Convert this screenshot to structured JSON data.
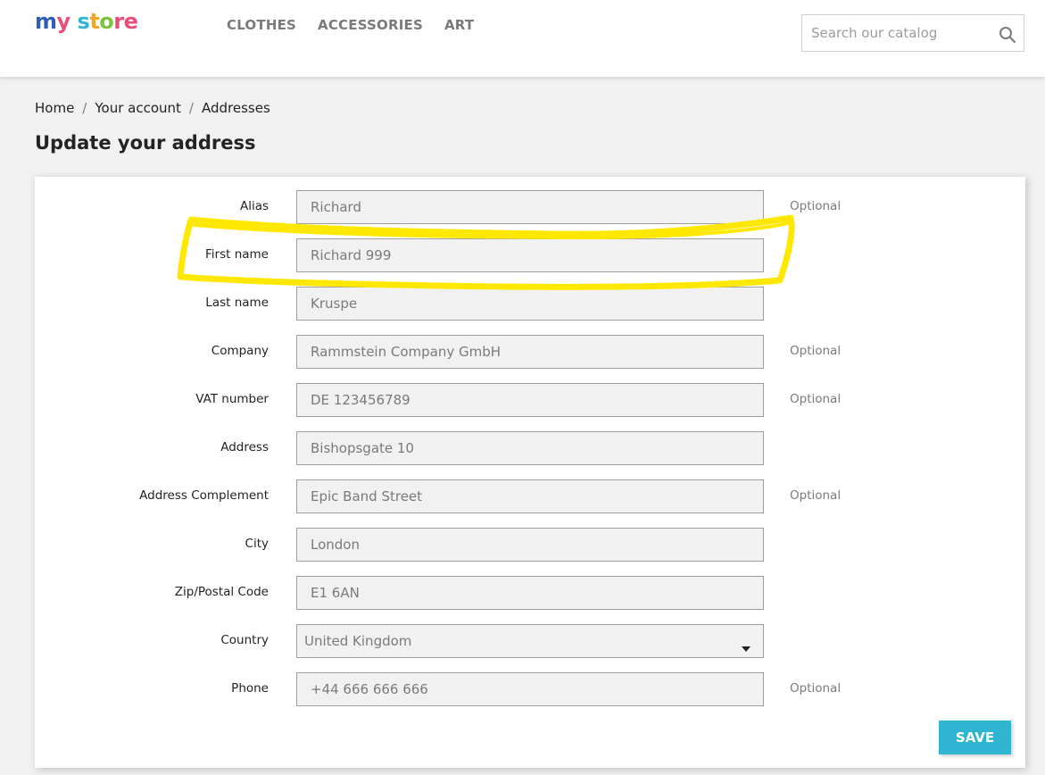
{
  "header": {
    "logo": [
      "m",
      "y",
      " s",
      "t",
      "o",
      "re"
    ],
    "nav": [
      "CLOTHES",
      "ACCESSORIES",
      "ART"
    ],
    "search_placeholder": "Search our catalog"
  },
  "breadcrumb": [
    "Home",
    "Your account",
    "Addresses"
  ],
  "breadcrumb_separator": "/",
  "page_title": "Update your address",
  "form": {
    "optional_label": "Optional",
    "fields": [
      {
        "label": "Alias",
        "value": "Richard",
        "optional": true
      },
      {
        "label": "First name",
        "value": "Richard 999",
        "optional": false
      },
      {
        "label": "Last name",
        "value": "Kruspe",
        "optional": false
      },
      {
        "label": "Company",
        "value": "Rammstein Company GmbH",
        "optional": true
      },
      {
        "label": "VAT number",
        "value": "DE 123456789",
        "optional": true
      },
      {
        "label": "Address",
        "value": "Bishopsgate 10",
        "optional": false
      },
      {
        "label": "Address Complement",
        "value": "Epic Band Street",
        "optional": true
      },
      {
        "label": "City",
        "value": "London",
        "optional": false
      },
      {
        "label": "Zip/Postal Code",
        "value": "E1 6AN",
        "optional": false
      },
      {
        "label": "Country",
        "value": "United Kingdom",
        "optional": false
      },
      {
        "label": "Phone",
        "value": "+44 666 666 666",
        "optional": true
      }
    ],
    "save_label": "SAVE"
  },
  "colors": {
    "accent": "#2fb5d2",
    "highlight": "#ffe800",
    "input_bg": "#f1f1f1"
  },
  "icons": [
    "search-icon",
    "caret-down-icon"
  ]
}
